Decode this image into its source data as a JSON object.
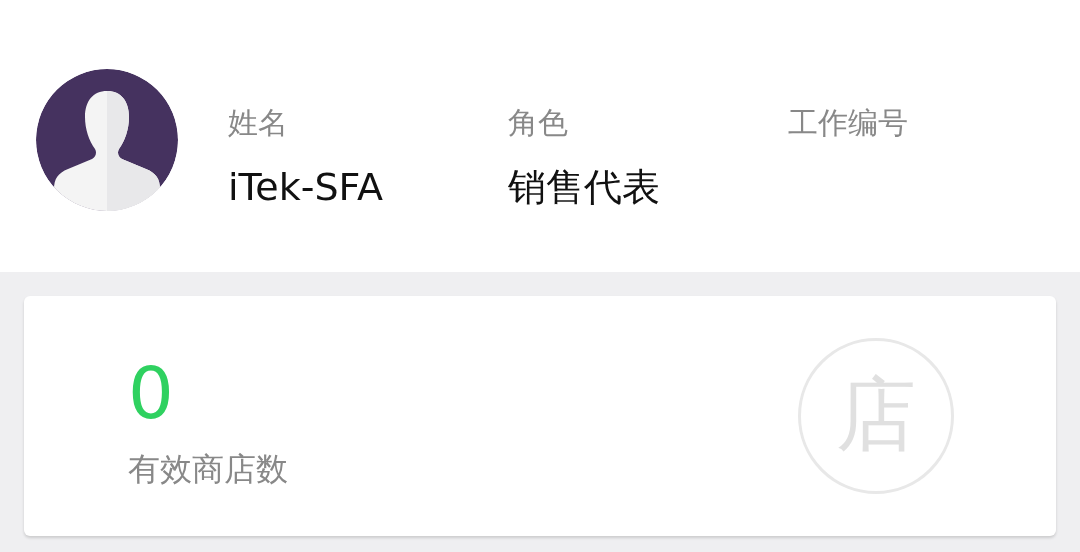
{
  "profile": {
    "fields": [
      {
        "label": "姓名",
        "value": "iTek-SFA"
      },
      {
        "label": "角色",
        "value": "销售代表"
      },
      {
        "label": "工作编号"
      }
    ]
  },
  "stats": [
    {
      "value": "0",
      "label": "有效商店数",
      "badge": "店"
    }
  ]
}
